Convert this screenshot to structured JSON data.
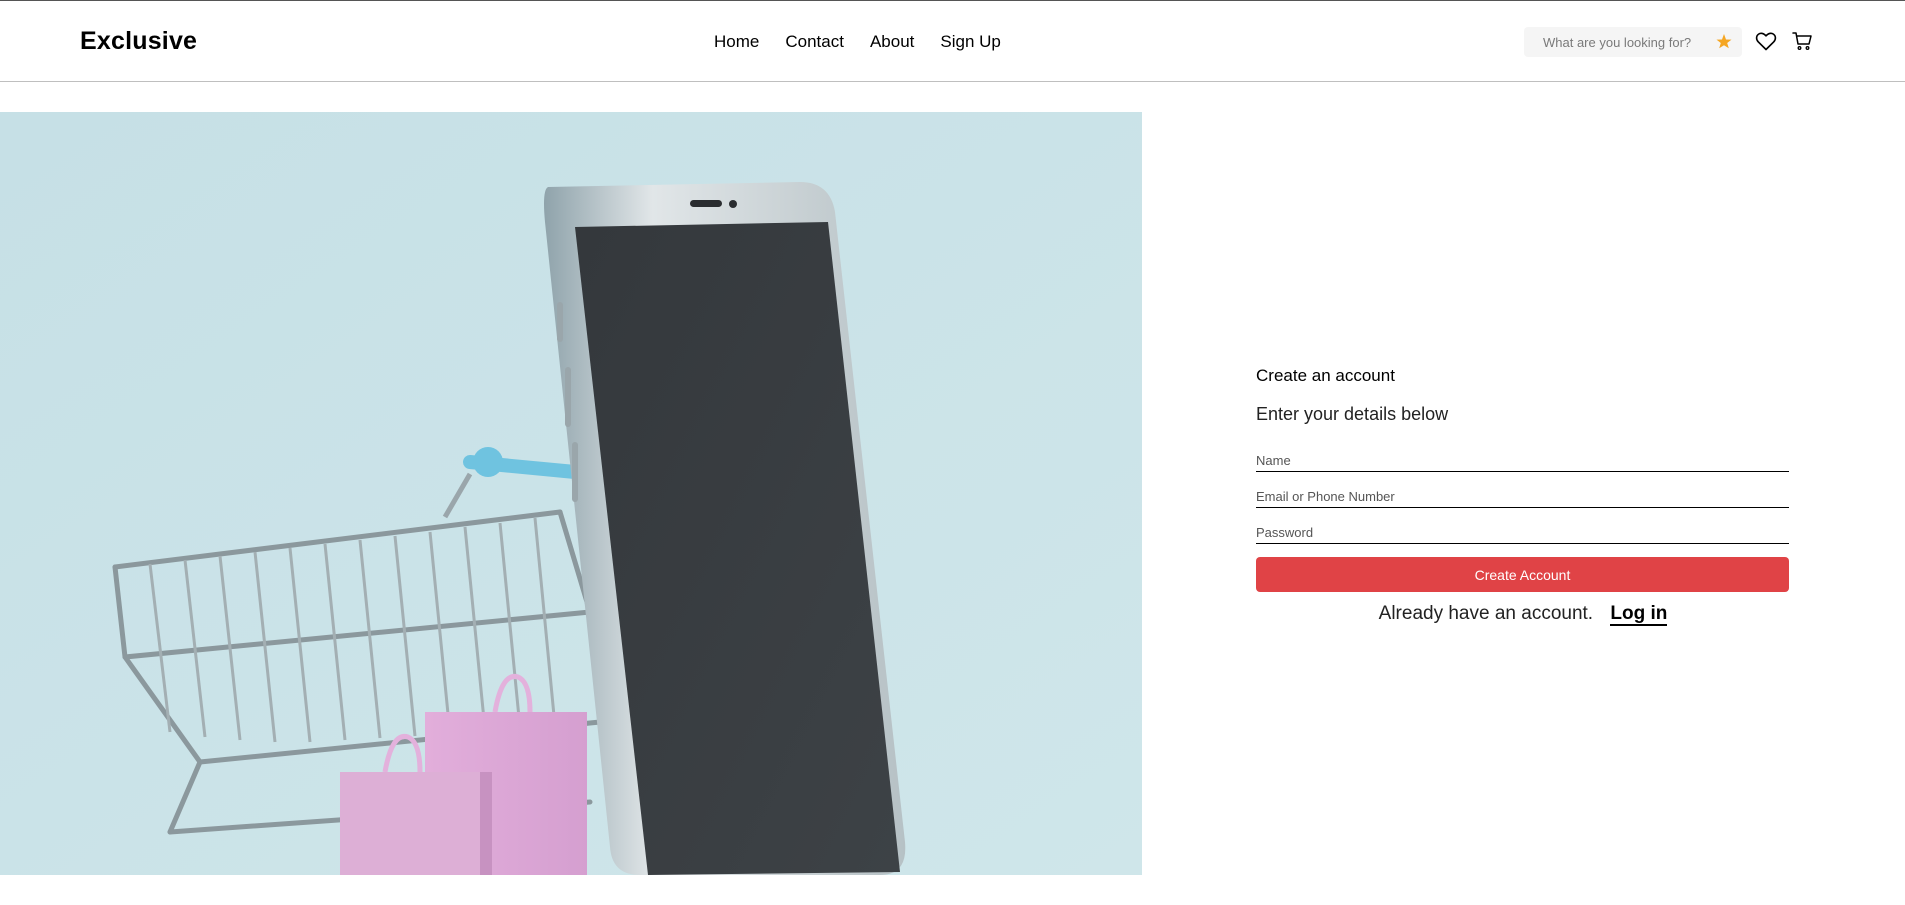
{
  "header": {
    "logo": "Exclusive",
    "nav": [
      "Home",
      "Contact",
      "About",
      "Sign Up"
    ],
    "search_placeholder": "What are you looking for?",
    "icons": [
      "star-icon",
      "heart-icon",
      "cart-icon"
    ],
    "accent_color": "#f5a623"
  },
  "hero": {
    "background_color": "#cbe3e8",
    "image_subject": "smartphone-with-shopping-cart-and-bags"
  },
  "form": {
    "title": "Create an account",
    "subtitle": "Enter your details below",
    "name_placeholder": "Name",
    "email_placeholder": "Email or Phone Number",
    "password_placeholder": "Password",
    "submit_label": "Create Account",
    "login_prompt": "Already have an account.",
    "login_link": "Log in",
    "button_color": "#e04346"
  }
}
